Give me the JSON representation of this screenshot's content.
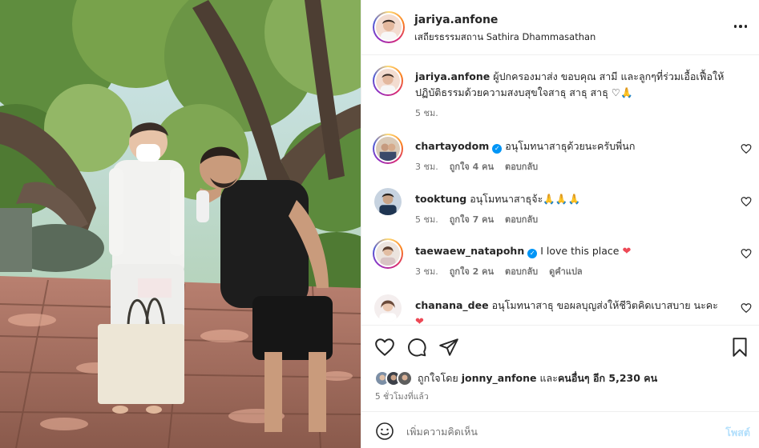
{
  "post": {
    "username": "jariya.anfone",
    "location": "เสถียรธรรมสถาน Sathira Dhammasathan",
    "more_icon": "more-horizontal-icon"
  },
  "caption": {
    "username": "jariya.anfone",
    "text": "ผู้ปกครองมาส่ง ขอบคุณ สามี และลูกๆที่ร่วมเอื้อเฟื้อให้ปฏิบัติธรรมด้วยความสงบสุขใจสาธุ สาธุ สาธุ ♡🙏",
    "time": "5 ชม."
  },
  "comments": [
    {
      "username": "chartayodom",
      "verified": true,
      "text": "อนุโมทนาสาธุด้วยนะครับพี่นก",
      "time": "3 ชม.",
      "likes": "ถูกใจ 4 คน",
      "reply": "ตอบกลับ",
      "translate": ""
    },
    {
      "username": "tooktung",
      "verified": false,
      "text": "อนุโมทนาสาธุจ้ะ🙏🙏🙏",
      "time": "5 ชม.",
      "likes": "ถูกใจ 7 คน",
      "reply": "ตอบกลับ",
      "translate": ""
    },
    {
      "username": "taewaew_natapohn",
      "verified": true,
      "text": "I love this place",
      "time": "3 ชม.",
      "likes": "ถูกใจ 2 คน",
      "reply": "ตอบกลับ",
      "translate": "ดูคำแปล"
    },
    {
      "username": "chanana_dee",
      "verified": false,
      "text": "อนุโมทนาสาธุ ขอผลบุญส่งให้ชีวิตคิดเบาสบาย นะคะ",
      "time": "",
      "likes": "",
      "reply": "",
      "translate": ""
    }
  ],
  "actions": {
    "like_icon": "heart-outline-icon",
    "comment_icon": "comment-icon",
    "share_icon": "share-send-icon",
    "save_icon": "bookmark-icon"
  },
  "likes": {
    "prefix": "ถูกใจโดย",
    "first_user": "jonny_anfone",
    "middle": " และ",
    "others": "คนอื่นๆ อีก 5,230 คน"
  },
  "time_ago": "5 ชั่วโมงที่แล้ว",
  "add_comment": {
    "placeholder": "เพิ่มความคิดเห็น",
    "post_label": "โพสต์",
    "emoji_icon": "emoji-smile-icon"
  },
  "colors": {
    "verified": "#0095f6",
    "heart_red": "#ed4956",
    "post_disabled": "#b2dffc",
    "secondary_text": "#737373"
  }
}
